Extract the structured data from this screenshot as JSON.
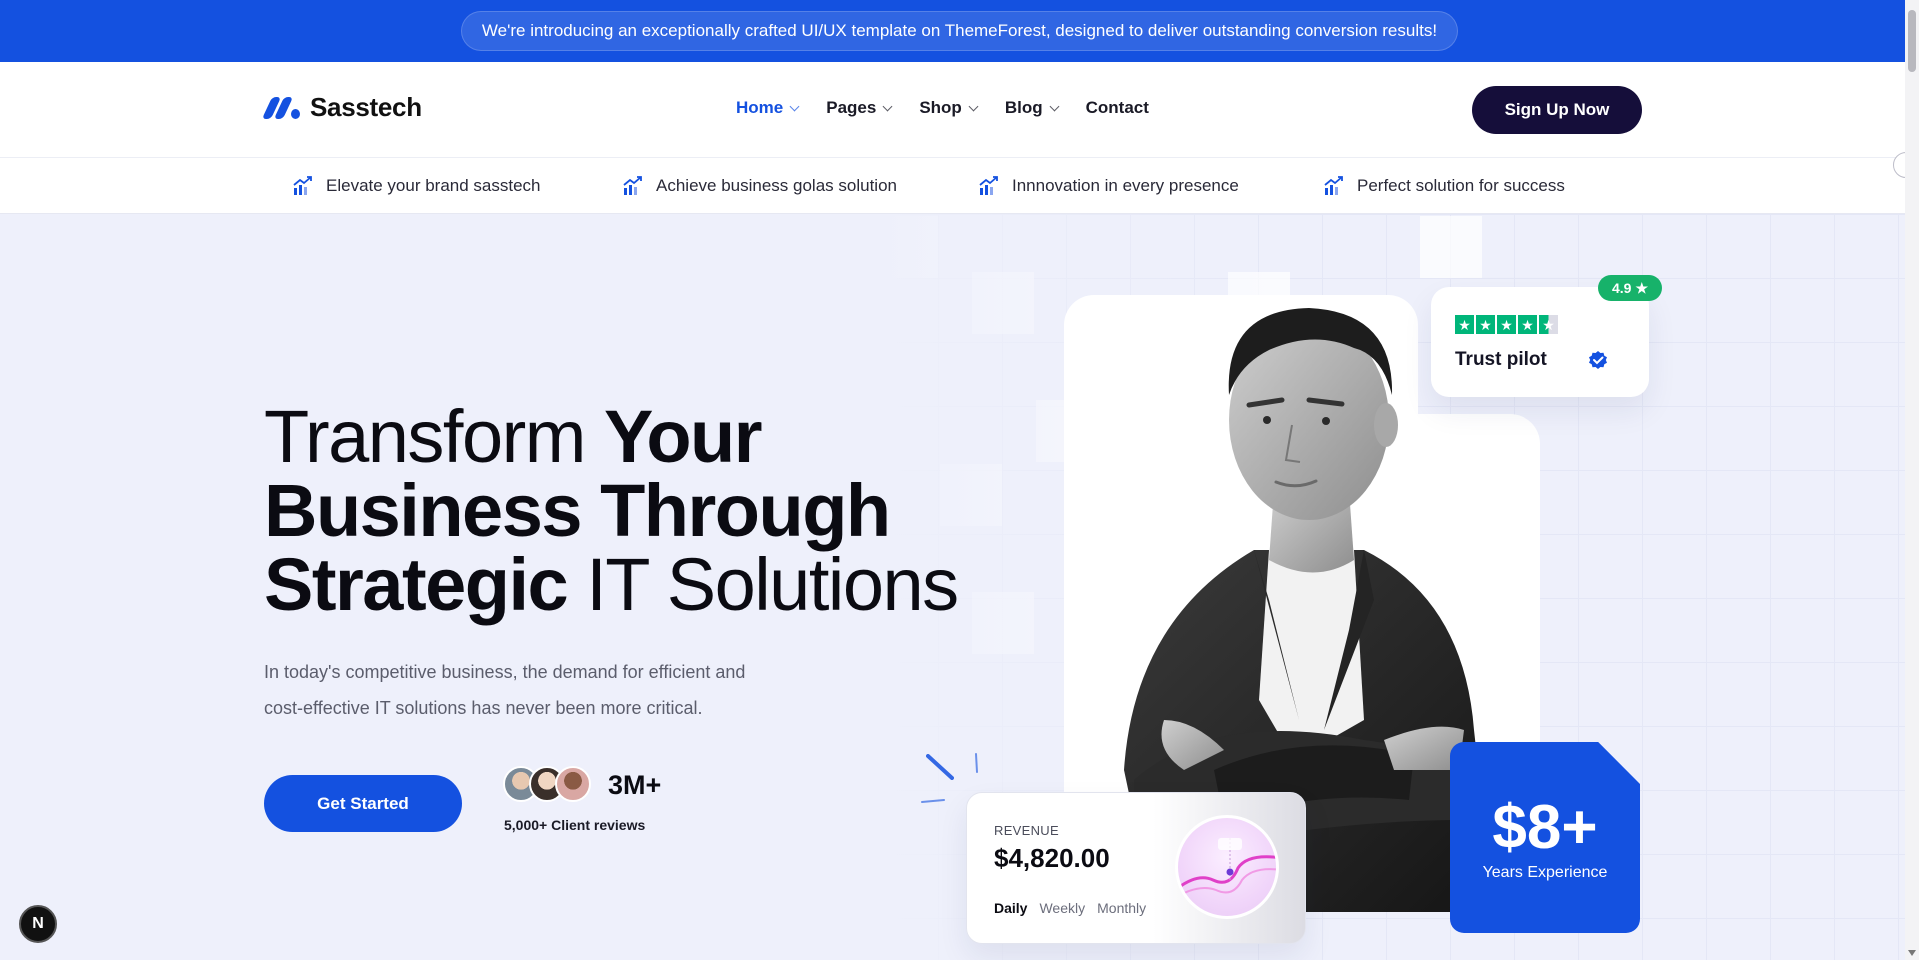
{
  "announcement": "We're introducing an exceptionally crafted UI/UX template on ThemeForest, designed to deliver outstanding conversion results!",
  "brand": {
    "name": "Sasstech",
    "accent": "#1451e0",
    "dark": "#150e3a"
  },
  "nav": {
    "items": [
      {
        "label": "Home",
        "has_dropdown": true,
        "active": true
      },
      {
        "label": "Pages",
        "has_dropdown": true
      },
      {
        "label": "Shop",
        "has_dropdown": true
      },
      {
        "label": "Blog",
        "has_dropdown": true
      },
      {
        "label": "Contact",
        "has_dropdown": false
      }
    ],
    "cta": "Sign Up Now"
  },
  "features": [
    {
      "label": "Elevate your brand sasstech",
      "icon": "growth-chart-icon"
    },
    {
      "label": "Achieve business golas solution",
      "icon": "growth-chart-icon"
    },
    {
      "label": "Innnovation in every presence",
      "icon": "growth-chart-icon"
    },
    {
      "label": "Perfect solution for success",
      "icon": "growth-chart-icon"
    }
  ],
  "hero": {
    "headline": {
      "line1_light": "Transform ",
      "line1_bold": "Your",
      "line2_bold": "Business Through",
      "line3_bold": "Strategic ",
      "line3_light": "IT Solutions"
    },
    "lead_line1": "In today's competitive business, the demand for efficient and",
    "lead_line2": "cost-effective IT solutions has never been more critical.",
    "cta": "Get Started",
    "reviews_count": "3M+",
    "reviews_label": "5,000+ Client reviews"
  },
  "trust": {
    "rating": "4.9",
    "label": "Trust pilot",
    "stars": 4.5
  },
  "revenue": {
    "label": "REVENUE",
    "value": "$4,820.00",
    "tabs": [
      "Daily",
      "Weekly",
      "Monthly"
    ],
    "selected_tab": "Daily"
  },
  "experience": {
    "value": "$8+",
    "label": "Years Experience"
  },
  "badge": "N"
}
